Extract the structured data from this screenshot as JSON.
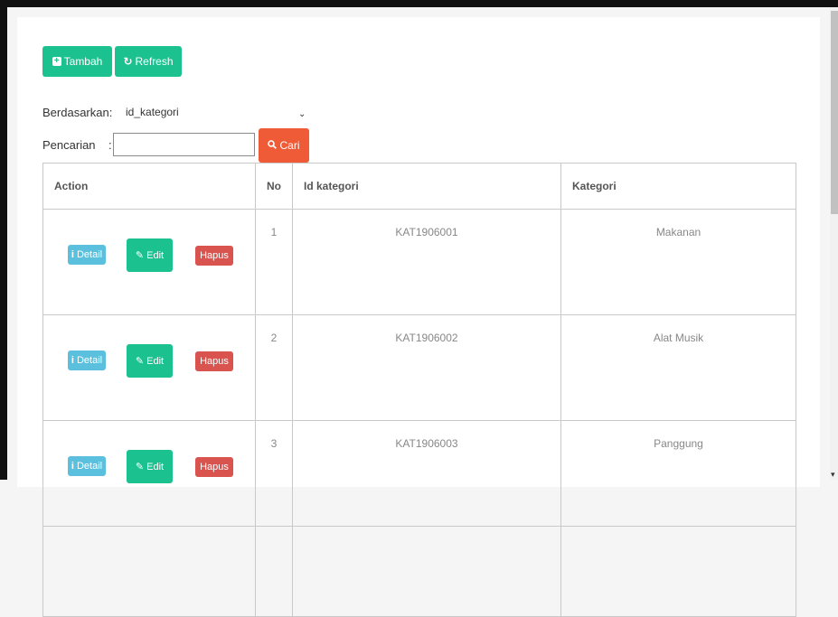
{
  "toolbar": {
    "add_label": "Tambah",
    "refresh_label": "Refresh"
  },
  "filter": {
    "by_label": "Berdasarkan:",
    "selected_field": "id_kategori",
    "search_label": "Pencarian",
    "search_separator": ":",
    "search_value": "",
    "search_button_label": "Cari"
  },
  "table": {
    "columns": [
      "Action",
      "No",
      "Id kategori",
      "Kategori"
    ],
    "action_labels": {
      "detail": "Detail",
      "edit": "Edit",
      "delete": "Hapus"
    },
    "rows": [
      {
        "no": "1",
        "id": "KAT1906001",
        "kategori": "Makanan"
      },
      {
        "no": "2",
        "id": "KAT1906002",
        "kategori": "Alat Musik"
      },
      {
        "no": "3",
        "id": "KAT1906003",
        "kategori": "Panggung"
      }
    ]
  },
  "colors": {
    "green": "#1bc28f",
    "red": "#d9534f",
    "blue": "#5bc0de",
    "orange": "#ef5a37"
  },
  "icons": {
    "add": "plus-square-icon",
    "refresh": "refresh-icon",
    "search": "search-icon",
    "detail": "info-icon",
    "edit": "edit-icon",
    "select": "chevron-down-icon"
  }
}
